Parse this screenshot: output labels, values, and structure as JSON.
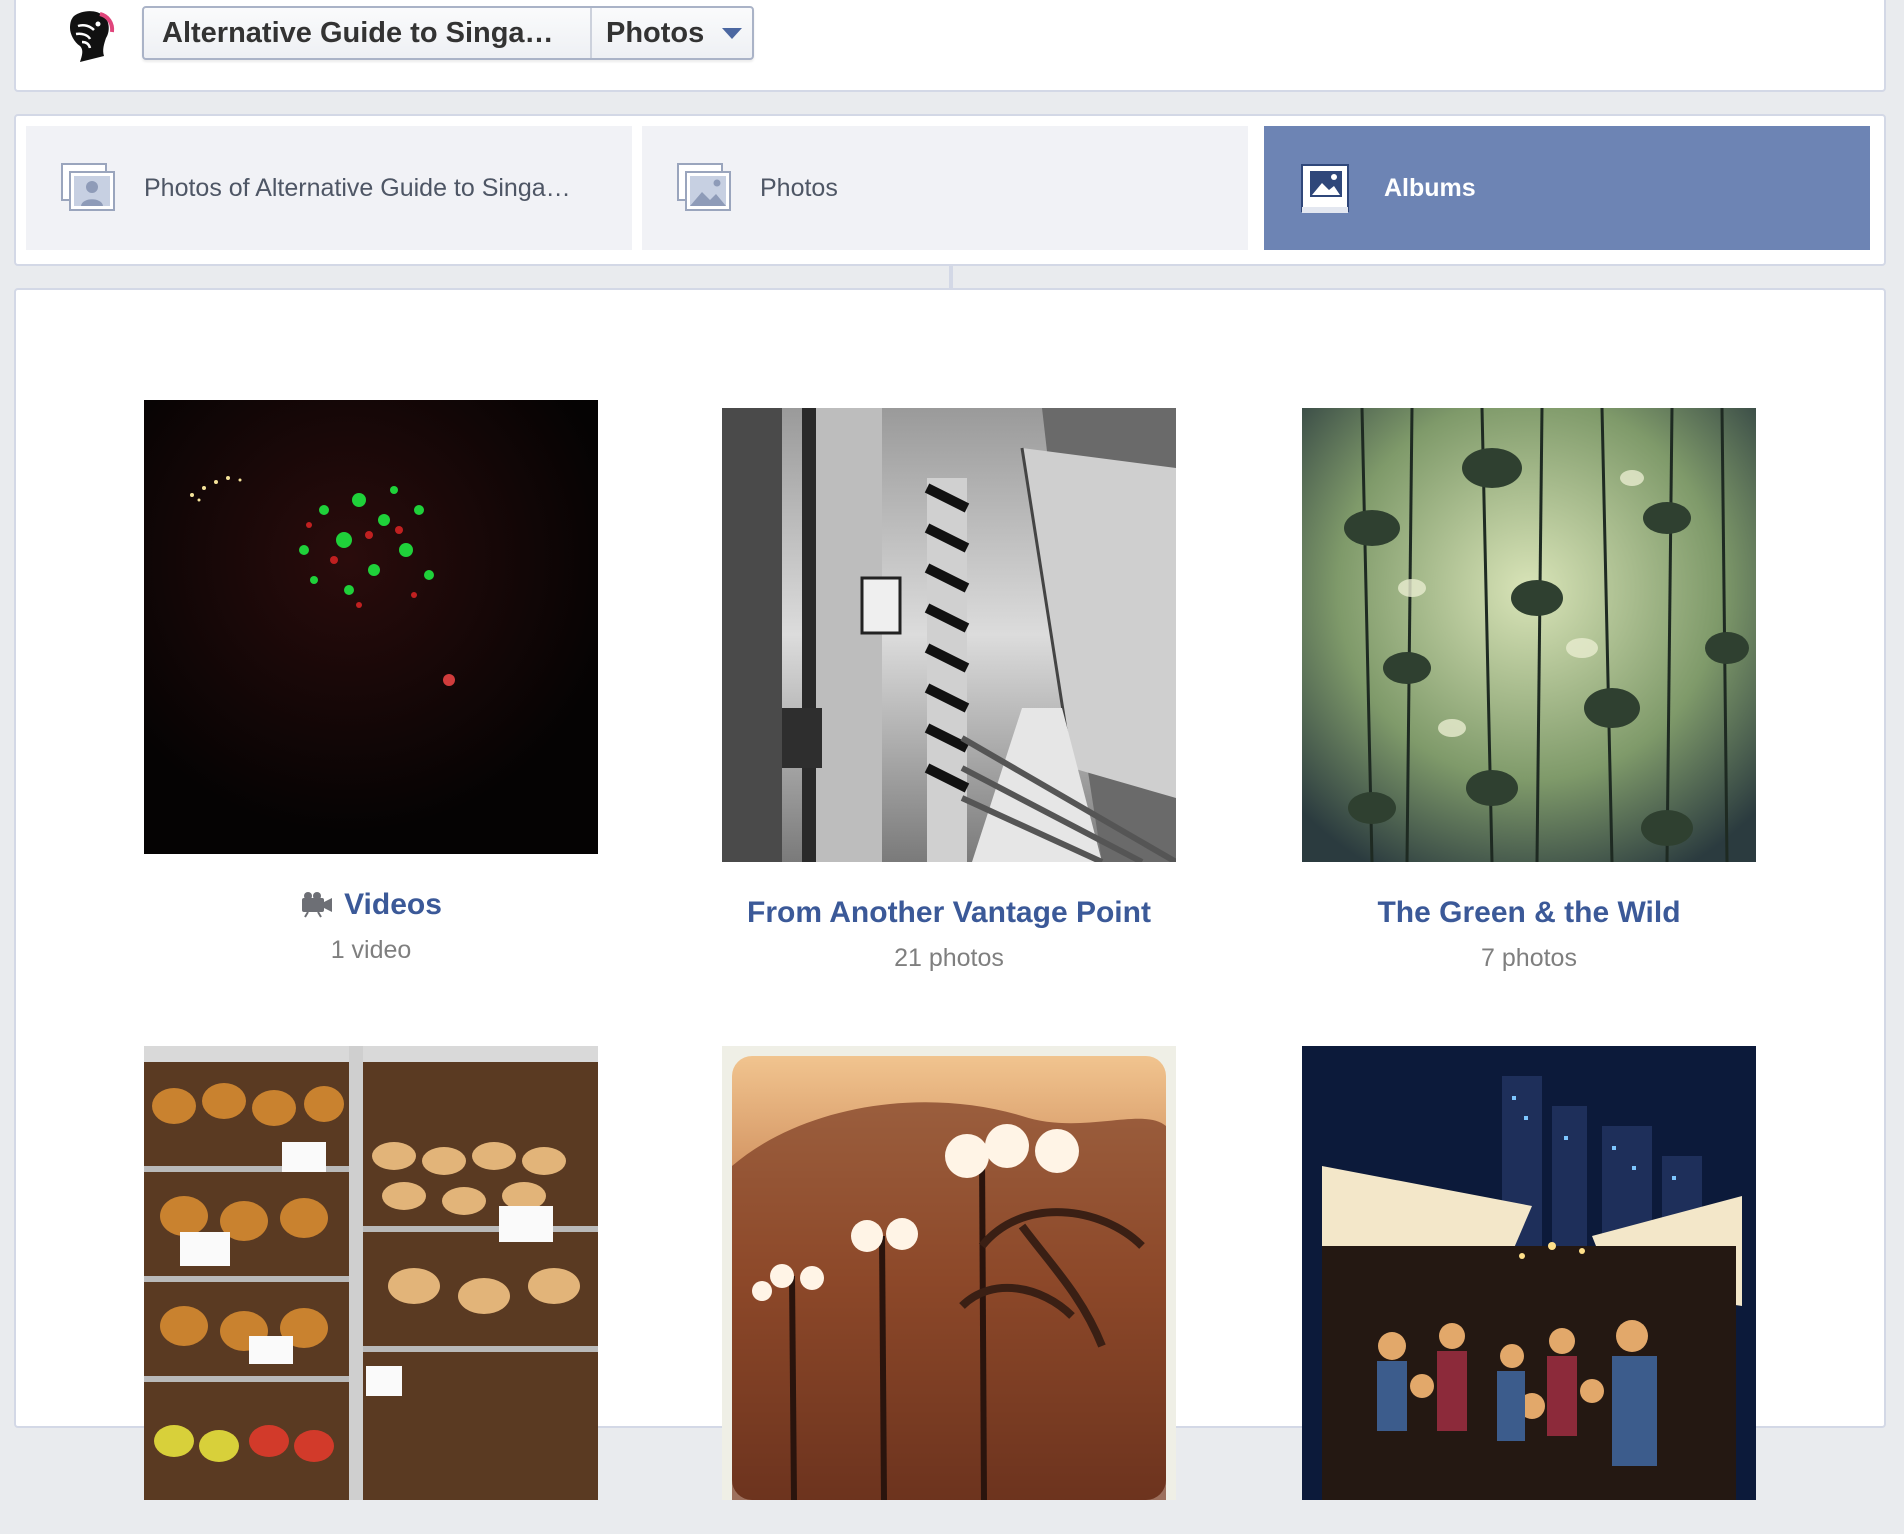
{
  "header": {
    "page_name": "Alternative Guide to Singa…",
    "section_selector": "Photos"
  },
  "tabs": [
    {
      "label": "Photos of Alternative Guide to Singa…",
      "icon": "user-photos-icon",
      "active": false
    },
    {
      "label": "Photos",
      "icon": "photos-icon",
      "active": false
    },
    {
      "label": "Albums",
      "icon": "album-icon",
      "active": true
    }
  ],
  "albums": [
    {
      "title": "Videos",
      "count": "1 video",
      "icon": "video-camera-icon",
      "thumbnail": "dark night lights"
    },
    {
      "title": "From Another Vantage Point",
      "count": "21 photos",
      "thumbnail": "black and white alley"
    },
    {
      "title": "The Green & the Wild",
      "count": "7 photos",
      "thumbnail": "hanging air plants"
    },
    {
      "title": "",
      "count": "",
      "thumbnail": "bakery display case"
    },
    {
      "title": "",
      "count": "",
      "thumbnail": "sunset lamps and palms"
    },
    {
      "title": "",
      "count": "",
      "thumbnail": "night market crowd and skyline"
    }
  ],
  "colors": {
    "active_tab": "#6d84b4",
    "link": "#3b5998",
    "background": "#e9ebee"
  }
}
